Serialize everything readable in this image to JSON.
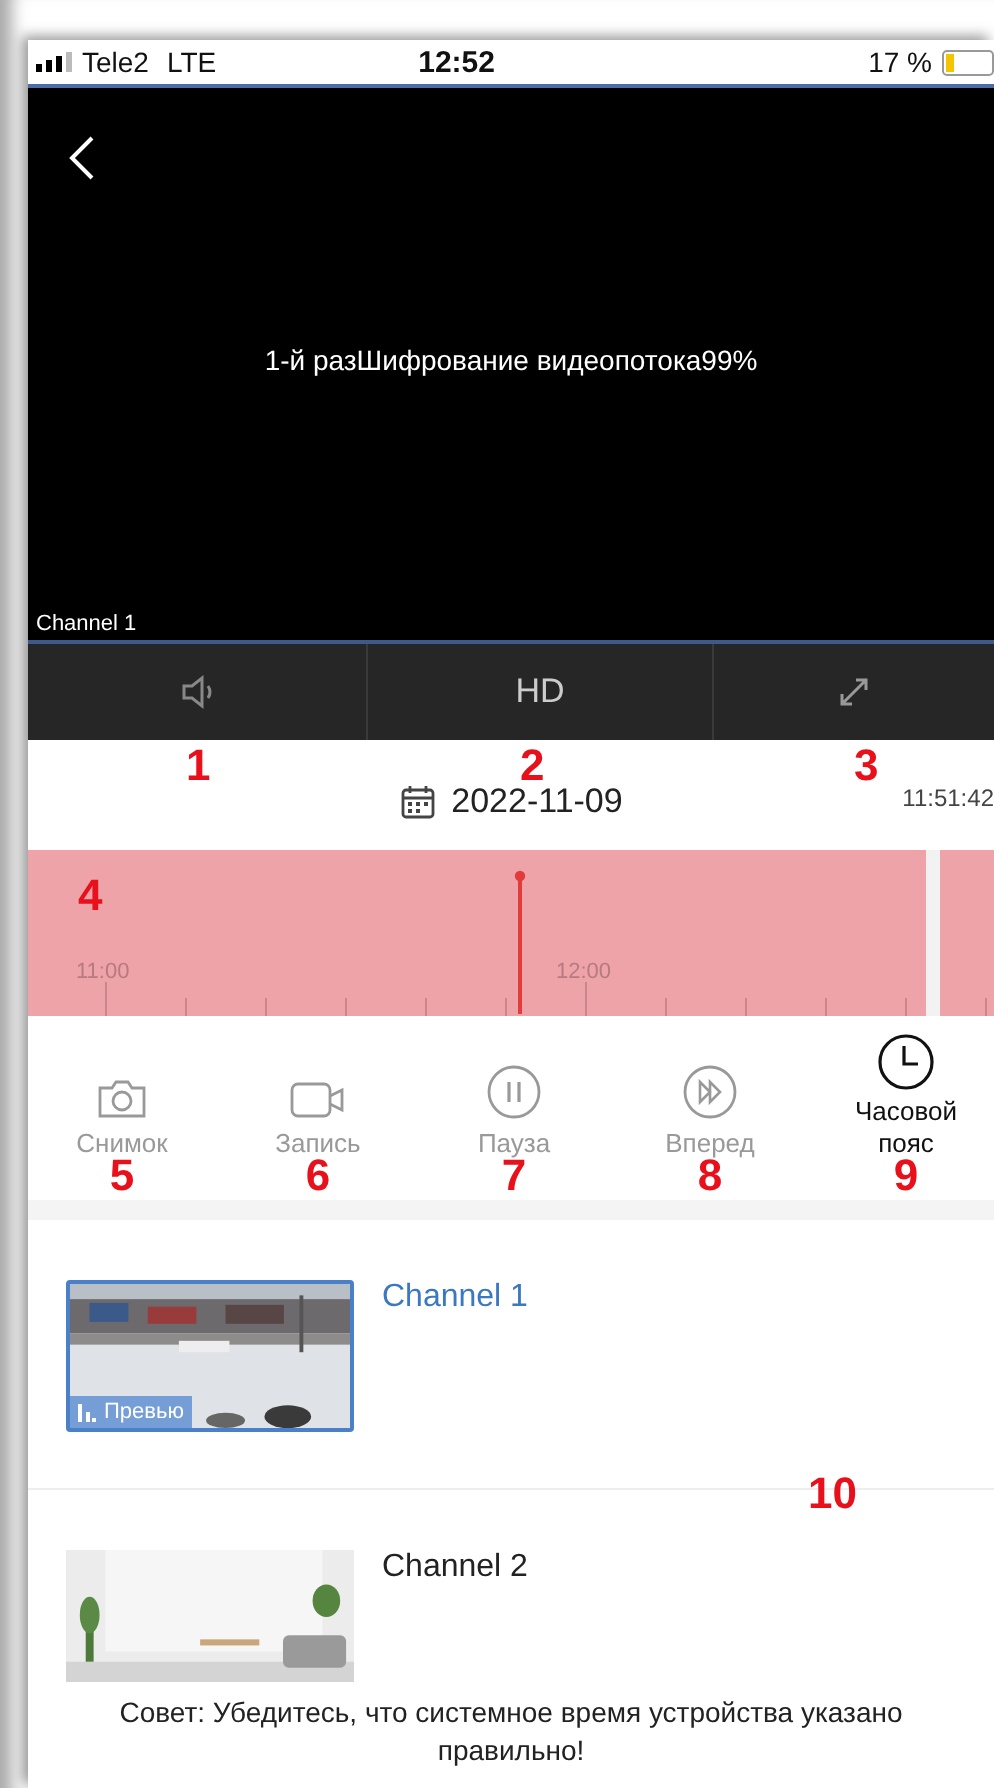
{
  "status_bar": {
    "carrier": "Tele2",
    "network": "LTE",
    "time": "12:52",
    "battery": "17 %"
  },
  "video": {
    "message": "1-й разШифрование видеопотока99%",
    "channel_label": "Channel 1"
  },
  "control_bar": [
    {
      "kind": "sound",
      "marker": "1"
    },
    {
      "kind": "text",
      "label": "HD",
      "marker": "2"
    },
    {
      "kind": "fullscreen",
      "marker": "3"
    }
  ],
  "date_row": {
    "date": "2022-11-09",
    "time": "11:51:42"
  },
  "timeline": {
    "tick_labels": [
      "11:00",
      "12:00"
    ],
    "marker": "4"
  },
  "actions": [
    {
      "kind": "snapshot",
      "label": "Снимок",
      "disabled": true,
      "marker": "5"
    },
    {
      "kind": "record",
      "label": "Запись",
      "disabled": true,
      "marker": "6"
    },
    {
      "kind": "pause",
      "label": "Пауза",
      "disabled": true,
      "marker": "7"
    },
    {
      "kind": "forward",
      "label": "Вперед",
      "disabled": true,
      "marker": "8"
    },
    {
      "kind": "timezone",
      "label": "Часовой пояс",
      "disabled": false,
      "marker": "9"
    }
  ],
  "channels": [
    {
      "name": "Channel 1",
      "selected": true,
      "overlay": "Превью"
    },
    {
      "name": "Channel 2",
      "selected": false
    }
  ],
  "channels_marker": "10",
  "tip": "Совет: Убедитесь, что системное время устройства указано правильно!"
}
